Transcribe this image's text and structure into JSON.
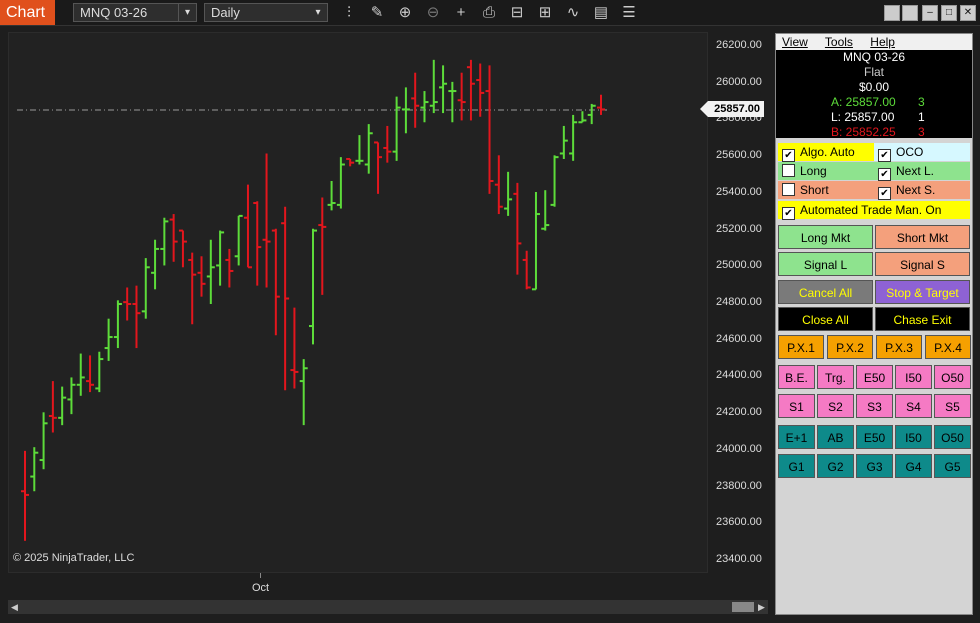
{
  "toolbar": {
    "tab": "Chart",
    "instrument": "MNQ 03-26",
    "timeframe": "Daily",
    "dropdown_glyph": "❯",
    "icons": [
      "bar-type-icon",
      "pencil-icon",
      "zoom-in-icon",
      "zoom-out-icon",
      "crosshair-icon",
      "properties-icon",
      "strategy-icon",
      "chart-trader-icon",
      "indicator-icon",
      "template-icon",
      "list-icon"
    ]
  },
  "chart": {
    "copyright": "© 2025 NinjaTrader, LLC",
    "last_price": "25857.00",
    "time_label": "Oct"
  },
  "chart_data": {
    "type": "ohlc",
    "ylim": [
      23300,
      26300
    ],
    "price_ticks": [
      "26200.00",
      "26000.00",
      "25800.00",
      "25600.00",
      "25400.00",
      "25200.00",
      "25000.00",
      "24800.00",
      "24600.00",
      "24400.00",
      "24200.00",
      "24000.00",
      "23800.00",
      "23600.00",
      "23400.00"
    ],
    "up_color": "#5ddc3a",
    "down_color": "#e3161d",
    "bars": [
      {
        "o": 23780,
        "h": 24000,
        "l": 23510,
        "c": 23760
      },
      {
        "o": 23860,
        "h": 24020,
        "l": 23780,
        "c": 23990
      },
      {
        "o": 23950,
        "h": 24210,
        "l": 23900,
        "c": 24150
      },
      {
        "o": 24190,
        "h": 24380,
        "l": 24100,
        "c": 24180
      },
      {
        "o": 24180,
        "h": 24350,
        "l": 24140,
        "c": 24290
      },
      {
        "o": 24280,
        "h": 24400,
        "l": 24200,
        "c": 24360
      },
      {
        "o": 24360,
        "h": 24530,
        "l": 24300,
        "c": 24400
      },
      {
        "o": 24380,
        "h": 24520,
        "l": 24320,
        "c": 24360
      },
      {
        "o": 24340,
        "h": 24540,
        "l": 24320,
        "c": 24500
      },
      {
        "o": 24560,
        "h": 24720,
        "l": 24490,
        "c": 24620
      },
      {
        "o": 24620,
        "h": 24820,
        "l": 24560,
        "c": 24800
      },
      {
        "o": 24810,
        "h": 24890,
        "l": 24710,
        "c": 24800
      },
      {
        "o": 24800,
        "h": 24900,
        "l": 24560,
        "c": 24750
      },
      {
        "o": 24760,
        "h": 25050,
        "l": 24720,
        "c": 25000
      },
      {
        "o": 24970,
        "h": 25150,
        "l": 24880,
        "c": 25100
      },
      {
        "o": 25100,
        "h": 25270,
        "l": 25010,
        "c": 25250
      },
      {
        "o": 25260,
        "h": 25290,
        "l": 25030,
        "c": 25140
      },
      {
        "o": 25200,
        "h": 25190,
        "l": 25000,
        "c": 25140
      },
      {
        "o": 25040,
        "h": 25080,
        "l": 24690,
        "c": 24960
      },
      {
        "o": 24970,
        "h": 25060,
        "l": 24840,
        "c": 24910
      },
      {
        "o": 24950,
        "h": 25150,
        "l": 24800,
        "c": 25000
      },
      {
        "o": 25010,
        "h": 25200,
        "l": 24900,
        "c": 25190
      },
      {
        "o": 25040,
        "h": 25100,
        "l": 24890,
        "c": 24980
      },
      {
        "o": 25060,
        "h": 25280,
        "l": 25010,
        "c": 25280
      },
      {
        "o": 25270,
        "h": 25450,
        "l": 25010,
        "c": 25000
      },
      {
        "o": 25350,
        "h": 25360,
        "l": 24900,
        "c": 25110
      },
      {
        "o": 25150,
        "h": 25620,
        "l": 24890,
        "c": 25140
      },
      {
        "o": 25200,
        "h": 25210,
        "l": 24630,
        "c": 24840
      },
      {
        "o": 25240,
        "h": 25330,
        "l": 24330,
        "c": 24830
      },
      {
        "o": 24440,
        "h": 24780,
        "l": 24340,
        "c": 24430
      },
      {
        "o": 24380,
        "h": 24500,
        "l": 24140,
        "c": 24450
      },
      {
        "o": 24680,
        "h": 25210,
        "l": 24580,
        "c": 25200
      },
      {
        "o": 25230,
        "h": 25380,
        "l": 24850,
        "c": 25220
      },
      {
        "o": 25340,
        "h": 25470,
        "l": 25310,
        "c": 25350
      },
      {
        "o": 25340,
        "h": 25600,
        "l": 25320,
        "c": 25560
      },
      {
        "o": 25590,
        "h": 25580,
        "l": 25550,
        "c": 25570
      },
      {
        "o": 25580,
        "h": 25720,
        "l": 25560,
        "c": 25580
      },
      {
        "o": 25560,
        "h": 25780,
        "l": 25510,
        "c": 25730
      },
      {
        "o": 25680,
        "h": 25670,
        "l": 25400,
        "c": 25600
      },
      {
        "o": 25650,
        "h": 25770,
        "l": 25570,
        "c": 25630
      },
      {
        "o": 25630,
        "h": 25930,
        "l": 25580,
        "c": 25870
      },
      {
        "o": 25860,
        "h": 25980,
        "l": 25730,
        "c": 25860
      },
      {
        "o": 25920,
        "h": 26060,
        "l": 25760,
        "c": 25880
      },
      {
        "o": 25870,
        "h": 25960,
        "l": 25790,
        "c": 25900
      },
      {
        "o": 25880,
        "h": 26130,
        "l": 25840,
        "c": 25900
      },
      {
        "o": 25980,
        "h": 26100,
        "l": 25840,
        "c": 26000
      },
      {
        "o": 25960,
        "h": 26010,
        "l": 25790,
        "c": 25960
      },
      {
        "o": 25910,
        "h": 26060,
        "l": 25800,
        "c": 25900
      },
      {
        "o": 26090,
        "h": 26130,
        "l": 25800,
        "c": 26000
      },
      {
        "o": 26020,
        "h": 26110,
        "l": 25820,
        "c": 25950
      },
      {
        "o": 25960,
        "h": 26100,
        "l": 25400,
        "c": 25470
      },
      {
        "o": 25450,
        "h": 25610,
        "l": 25290,
        "c": 25330
      },
      {
        "o": 25320,
        "h": 25520,
        "l": 25280,
        "c": 25370
      },
      {
        "o": 25400,
        "h": 25460,
        "l": 24960,
        "c": 25130
      },
      {
        "o": 25040,
        "h": 25090,
        "l": 24880,
        "c": 24890
      },
      {
        "o": 24880,
        "h": 25410,
        "l": 24880,
        "c": 25290
      },
      {
        "o": 25210,
        "h": 25420,
        "l": 25200,
        "c": 25230
      },
      {
        "o": 25340,
        "h": 25610,
        "l": 25330,
        "c": 25600
      },
      {
        "o": 25620,
        "h": 25770,
        "l": 25590,
        "c": 25690
      },
      {
        "o": 25620,
        "h": 25830,
        "l": 25580,
        "c": 25790
      },
      {
        "o": 25790,
        "h": 25850,
        "l": 25790,
        "c": 25800
      },
      {
        "o": 25830,
        "h": 25890,
        "l": 25780,
        "c": 25880
      },
      {
        "o": 25870,
        "h": 25940,
        "l": 25830,
        "c": 25860
      }
    ]
  },
  "panel": {
    "menu": [
      "View",
      "Tools",
      "Help"
    ],
    "instrument": "MNQ 03-26",
    "position": "Flat",
    "pnl": "$0.00",
    "ask": "A: 25857.00",
    "ask_size": "3",
    "last": "L: 25857.00",
    "last_size": "1",
    "bid": "B: 25852.25",
    "bid_size": "3",
    "checks": [
      {
        "label": "Algo. Auto",
        "checked": true
      },
      {
        "label": "OCO",
        "checked": true
      },
      {
        "label": "Long",
        "checked": false
      },
      {
        "label": "Next L.",
        "checked": true
      },
      {
        "label": "Short",
        "checked": false
      },
      {
        "label": "Next S.",
        "checked": true
      },
      {
        "label": "Automated Trade Man. On",
        "checked": true
      }
    ],
    "buttons": {
      "long_mkt": "Long Mkt",
      "short_mkt": "Short Mkt",
      "signal_l": "Signal L",
      "signal_s": "Signal S",
      "cancel_all": "Cancel All",
      "stop_target": "Stop & Target",
      "close_all": "Close All",
      "chase_exit": "Chase Exit"
    },
    "px": [
      "P.X.1",
      "P.X.2",
      "P.X.3",
      "P.X.4"
    ],
    "pink1": [
      "B.E.",
      "Trg.",
      "E50",
      "I50",
      "O50"
    ],
    "pink2": [
      "S1",
      "S2",
      "S3",
      "S4",
      "S5"
    ],
    "teal1": [
      "E+1",
      "AB",
      "E50",
      "I50",
      "O50"
    ],
    "teal2": [
      "G1",
      "G2",
      "G3",
      "G4",
      "G5"
    ]
  }
}
